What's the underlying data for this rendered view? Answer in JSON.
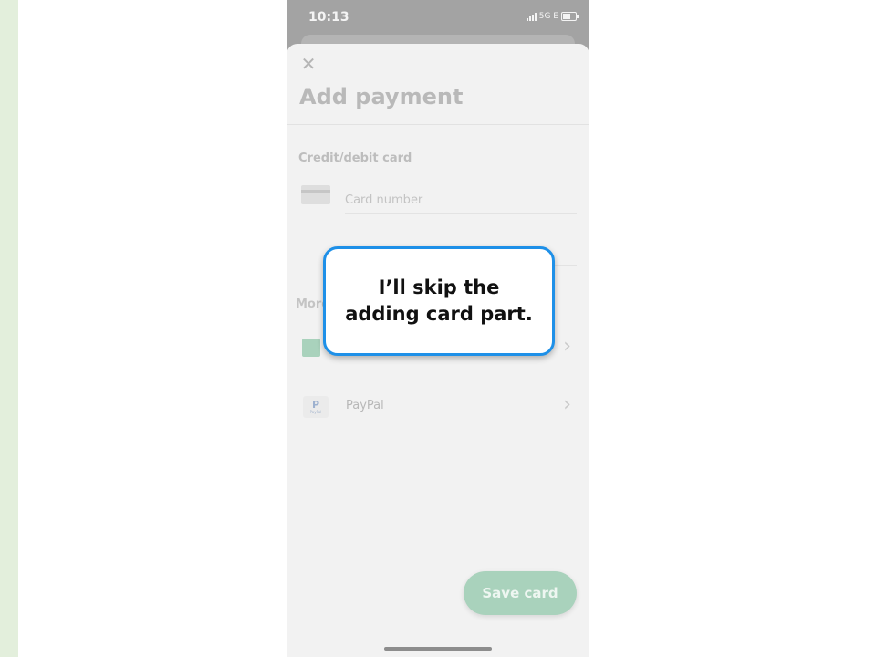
{
  "status_bar": {
    "time": "10:13",
    "network": "5G E"
  },
  "sheet": {
    "close_icon": "close-icon",
    "title": "Add payment",
    "credit_section_label": "Credit/debit card",
    "card_number_placeholder": "Card number",
    "more_label": "More",
    "option_one_subtext": "",
    "paypal_label": "PayPal",
    "paypal_logo_text": "PayPal",
    "save_button_label": "Save card"
  },
  "callout": {
    "text": "I’ll skip the adding card part."
  },
  "colors": {
    "accent": "#a9d2bc",
    "callout_border": "#1e90e8",
    "left_strip": "#e3efdc"
  }
}
